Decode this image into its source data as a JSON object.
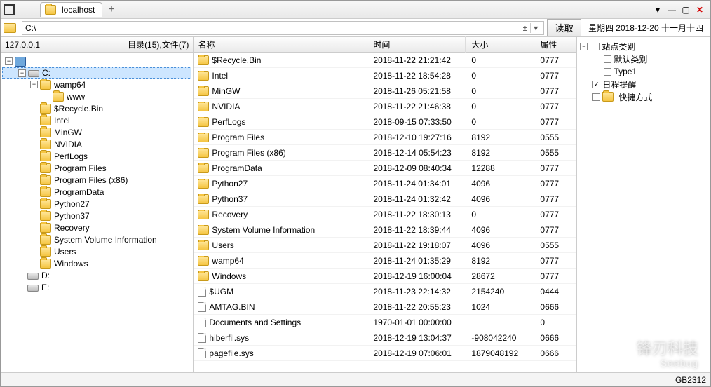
{
  "tab": {
    "title": "localhost"
  },
  "address": {
    "path": "C:\\",
    "read_label": "读取"
  },
  "date_label": "星期四 2018-12-20 十一月十四",
  "tree_header": {
    "ip": "127.0.0.1",
    "summary": "目录(15),文件(7)"
  },
  "tree_root_label": "C:",
  "tree": [
    {
      "indent": 0,
      "icon": "computer",
      "label": "",
      "exp": "-",
      "sel": false
    },
    {
      "indent": 1,
      "icon": "drive",
      "label": "C:",
      "exp": "-",
      "sel": true
    },
    {
      "indent": 2,
      "icon": "folder",
      "label": "wamp64",
      "exp": "-"
    },
    {
      "indent": 3,
      "icon": "folder",
      "label": "www",
      "exp": ""
    },
    {
      "indent": 2,
      "icon": "folder",
      "label": "$Recycle.Bin",
      "exp": ""
    },
    {
      "indent": 2,
      "icon": "folder",
      "label": "Intel",
      "exp": ""
    },
    {
      "indent": 2,
      "icon": "folder",
      "label": "MinGW",
      "exp": ""
    },
    {
      "indent": 2,
      "icon": "folder",
      "label": "NVIDIA",
      "exp": ""
    },
    {
      "indent": 2,
      "icon": "folder",
      "label": "PerfLogs",
      "exp": ""
    },
    {
      "indent": 2,
      "icon": "folder",
      "label": "Program Files",
      "exp": ""
    },
    {
      "indent": 2,
      "icon": "folder",
      "label": "Program Files (x86)",
      "exp": ""
    },
    {
      "indent": 2,
      "icon": "folder",
      "label": "ProgramData",
      "exp": ""
    },
    {
      "indent": 2,
      "icon": "folder",
      "label": "Python27",
      "exp": ""
    },
    {
      "indent": 2,
      "icon": "folder",
      "label": "Python37",
      "exp": ""
    },
    {
      "indent": 2,
      "icon": "folder",
      "label": "Recovery",
      "exp": ""
    },
    {
      "indent": 2,
      "icon": "folder",
      "label": "System Volume Information",
      "exp": ""
    },
    {
      "indent": 2,
      "icon": "folder",
      "label": "Users",
      "exp": ""
    },
    {
      "indent": 2,
      "icon": "folder",
      "label": "Windows",
      "exp": ""
    },
    {
      "indent": 1,
      "icon": "drive",
      "label": "D:",
      "exp": ""
    },
    {
      "indent": 1,
      "icon": "drive",
      "label": "E:",
      "exp": ""
    }
  ],
  "list_headers": {
    "name": "名称",
    "time": "时间",
    "size": "大小",
    "attr": "属性"
  },
  "files": [
    {
      "icon": "folder",
      "name": "$Recycle.Bin",
      "time": "2018-11-22 21:21:42",
      "size": "0",
      "attr": "0777"
    },
    {
      "icon": "folder",
      "name": "Intel",
      "time": "2018-11-22 18:54:28",
      "size": "0",
      "attr": "0777"
    },
    {
      "icon": "folder",
      "name": "MinGW",
      "time": "2018-11-26 05:21:58",
      "size": "0",
      "attr": "0777"
    },
    {
      "icon": "folder",
      "name": "NVIDIA",
      "time": "2018-11-22 21:46:38",
      "size": "0",
      "attr": "0777"
    },
    {
      "icon": "folder",
      "name": "PerfLogs",
      "time": "2018-09-15 07:33:50",
      "size": "0",
      "attr": "0777"
    },
    {
      "icon": "folder",
      "name": "Program Files",
      "time": "2018-12-10 19:27:16",
      "size": "8192",
      "attr": "0555"
    },
    {
      "icon": "folder",
      "name": "Program Files (x86)",
      "time": "2018-12-14 05:54:23",
      "size": "8192",
      "attr": "0555"
    },
    {
      "icon": "folder",
      "name": "ProgramData",
      "time": "2018-12-09 08:40:34",
      "size": "12288",
      "attr": "0777"
    },
    {
      "icon": "folder",
      "name": "Python27",
      "time": "2018-11-24 01:34:01",
      "size": "4096",
      "attr": "0777"
    },
    {
      "icon": "folder",
      "name": "Python37",
      "time": "2018-11-24 01:32:42",
      "size": "4096",
      "attr": "0777"
    },
    {
      "icon": "folder",
      "name": "Recovery",
      "time": "2018-11-22 18:30:13",
      "size": "0",
      "attr": "0777"
    },
    {
      "icon": "folder",
      "name": "System Volume Information",
      "time": "2018-11-22 18:39:44",
      "size": "4096",
      "attr": "0777"
    },
    {
      "icon": "folder",
      "name": "Users",
      "time": "2018-11-22 19:18:07",
      "size": "4096",
      "attr": "0555"
    },
    {
      "icon": "folder",
      "name": "wamp64",
      "time": "2018-11-24 01:35:29",
      "size": "8192",
      "attr": "0777"
    },
    {
      "icon": "folder",
      "name": "Windows",
      "time": "2018-12-19 16:00:04",
      "size": "28672",
      "attr": "0777"
    },
    {
      "icon": "file",
      "name": "$UGM",
      "time": "2018-11-23 22:14:32",
      "size": "2154240",
      "attr": "0444"
    },
    {
      "icon": "file",
      "name": "AMTAG.BIN",
      "time": "2018-11-22 20:55:23",
      "size": "1024",
      "attr": "0666"
    },
    {
      "icon": "file",
      "name": "Documents and Settings",
      "time": "1970-01-01 00:00:00",
      "size": "",
      "attr": "0"
    },
    {
      "icon": "file",
      "name": "hiberfil.sys",
      "time": "2018-12-19 13:04:37",
      "size": "-908042240",
      "attr": "0666"
    },
    {
      "icon": "file",
      "name": "pagefile.sys",
      "time": "2018-12-19 07:06:01",
      "size": "1879048192",
      "attr": "0666"
    }
  ],
  "side": {
    "root": "站点类别",
    "items": [
      {
        "label": "默认类别",
        "checked": false,
        "indent": 1
      },
      {
        "label": "Type1",
        "checked": false,
        "indent": 1
      },
      {
        "label": "日程提醒",
        "checked": true,
        "indent": 0
      },
      {
        "label": "快捷方式",
        "checked": false,
        "indent": 0,
        "icon": "folder"
      }
    ]
  },
  "status": {
    "encoding": "GB2312"
  },
  "watermark": {
    "main": "锋刃科技",
    "sub": "Seebug"
  }
}
